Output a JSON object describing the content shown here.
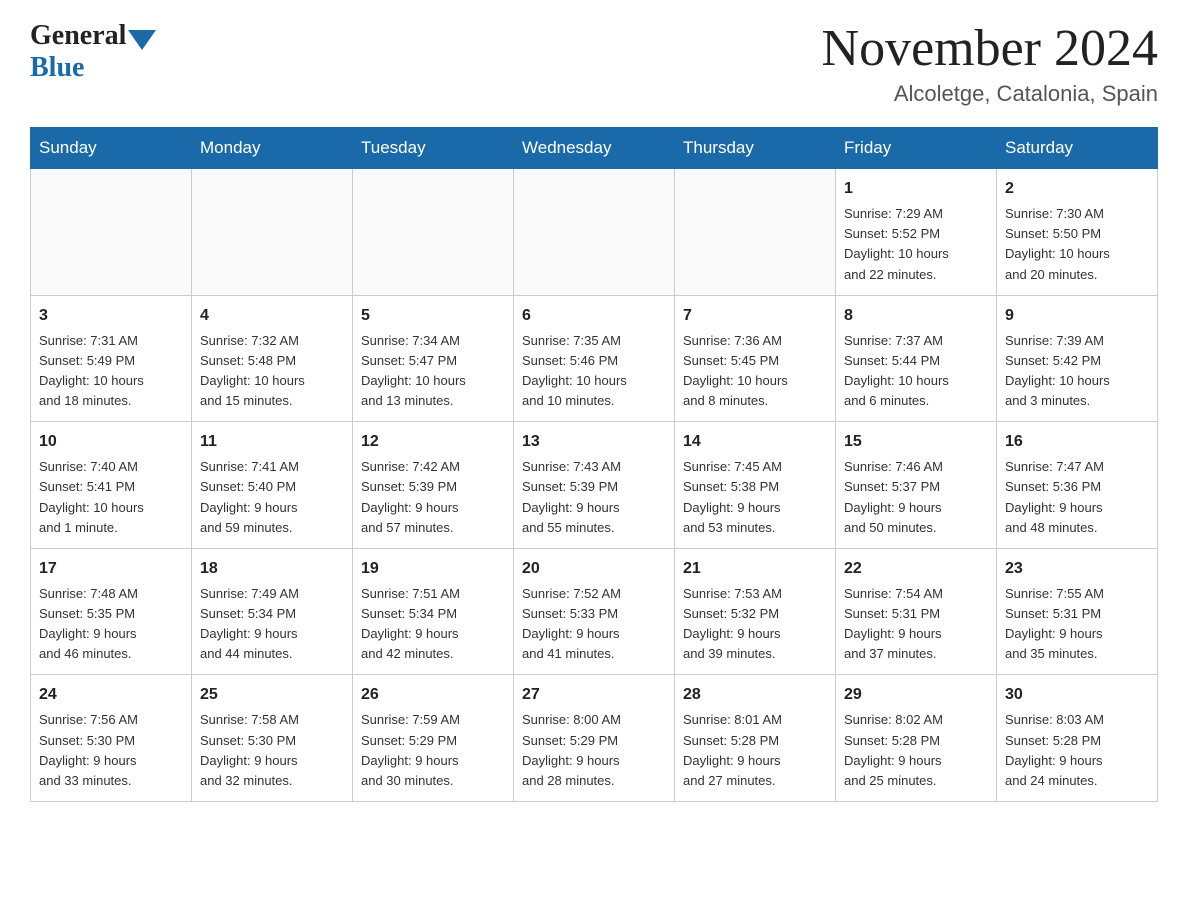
{
  "header": {
    "logo_general": "General",
    "logo_blue": "Blue",
    "month_title": "November 2024",
    "location": "Alcoletge, Catalonia, Spain"
  },
  "weekdays": [
    "Sunday",
    "Monday",
    "Tuesday",
    "Wednesday",
    "Thursday",
    "Friday",
    "Saturday"
  ],
  "weeks": [
    [
      {
        "day": "",
        "info": ""
      },
      {
        "day": "",
        "info": ""
      },
      {
        "day": "",
        "info": ""
      },
      {
        "day": "",
        "info": ""
      },
      {
        "day": "",
        "info": ""
      },
      {
        "day": "1",
        "info": "Sunrise: 7:29 AM\nSunset: 5:52 PM\nDaylight: 10 hours\nand 22 minutes."
      },
      {
        "day": "2",
        "info": "Sunrise: 7:30 AM\nSunset: 5:50 PM\nDaylight: 10 hours\nand 20 minutes."
      }
    ],
    [
      {
        "day": "3",
        "info": "Sunrise: 7:31 AM\nSunset: 5:49 PM\nDaylight: 10 hours\nand 18 minutes."
      },
      {
        "day": "4",
        "info": "Sunrise: 7:32 AM\nSunset: 5:48 PM\nDaylight: 10 hours\nand 15 minutes."
      },
      {
        "day": "5",
        "info": "Sunrise: 7:34 AM\nSunset: 5:47 PM\nDaylight: 10 hours\nand 13 minutes."
      },
      {
        "day": "6",
        "info": "Sunrise: 7:35 AM\nSunset: 5:46 PM\nDaylight: 10 hours\nand 10 minutes."
      },
      {
        "day": "7",
        "info": "Sunrise: 7:36 AM\nSunset: 5:45 PM\nDaylight: 10 hours\nand 8 minutes."
      },
      {
        "day": "8",
        "info": "Sunrise: 7:37 AM\nSunset: 5:44 PM\nDaylight: 10 hours\nand 6 minutes."
      },
      {
        "day": "9",
        "info": "Sunrise: 7:39 AM\nSunset: 5:42 PM\nDaylight: 10 hours\nand 3 minutes."
      }
    ],
    [
      {
        "day": "10",
        "info": "Sunrise: 7:40 AM\nSunset: 5:41 PM\nDaylight: 10 hours\nand 1 minute."
      },
      {
        "day": "11",
        "info": "Sunrise: 7:41 AM\nSunset: 5:40 PM\nDaylight: 9 hours\nand 59 minutes."
      },
      {
        "day": "12",
        "info": "Sunrise: 7:42 AM\nSunset: 5:39 PM\nDaylight: 9 hours\nand 57 minutes."
      },
      {
        "day": "13",
        "info": "Sunrise: 7:43 AM\nSunset: 5:39 PM\nDaylight: 9 hours\nand 55 minutes."
      },
      {
        "day": "14",
        "info": "Sunrise: 7:45 AM\nSunset: 5:38 PM\nDaylight: 9 hours\nand 53 minutes."
      },
      {
        "day": "15",
        "info": "Sunrise: 7:46 AM\nSunset: 5:37 PM\nDaylight: 9 hours\nand 50 minutes."
      },
      {
        "day": "16",
        "info": "Sunrise: 7:47 AM\nSunset: 5:36 PM\nDaylight: 9 hours\nand 48 minutes."
      }
    ],
    [
      {
        "day": "17",
        "info": "Sunrise: 7:48 AM\nSunset: 5:35 PM\nDaylight: 9 hours\nand 46 minutes."
      },
      {
        "day": "18",
        "info": "Sunrise: 7:49 AM\nSunset: 5:34 PM\nDaylight: 9 hours\nand 44 minutes."
      },
      {
        "day": "19",
        "info": "Sunrise: 7:51 AM\nSunset: 5:34 PM\nDaylight: 9 hours\nand 42 minutes."
      },
      {
        "day": "20",
        "info": "Sunrise: 7:52 AM\nSunset: 5:33 PM\nDaylight: 9 hours\nand 41 minutes."
      },
      {
        "day": "21",
        "info": "Sunrise: 7:53 AM\nSunset: 5:32 PM\nDaylight: 9 hours\nand 39 minutes."
      },
      {
        "day": "22",
        "info": "Sunrise: 7:54 AM\nSunset: 5:31 PM\nDaylight: 9 hours\nand 37 minutes."
      },
      {
        "day": "23",
        "info": "Sunrise: 7:55 AM\nSunset: 5:31 PM\nDaylight: 9 hours\nand 35 minutes."
      }
    ],
    [
      {
        "day": "24",
        "info": "Sunrise: 7:56 AM\nSunset: 5:30 PM\nDaylight: 9 hours\nand 33 minutes."
      },
      {
        "day": "25",
        "info": "Sunrise: 7:58 AM\nSunset: 5:30 PM\nDaylight: 9 hours\nand 32 minutes."
      },
      {
        "day": "26",
        "info": "Sunrise: 7:59 AM\nSunset: 5:29 PM\nDaylight: 9 hours\nand 30 minutes."
      },
      {
        "day": "27",
        "info": "Sunrise: 8:00 AM\nSunset: 5:29 PM\nDaylight: 9 hours\nand 28 minutes."
      },
      {
        "day": "28",
        "info": "Sunrise: 8:01 AM\nSunset: 5:28 PM\nDaylight: 9 hours\nand 27 minutes."
      },
      {
        "day": "29",
        "info": "Sunrise: 8:02 AM\nSunset: 5:28 PM\nDaylight: 9 hours\nand 25 minutes."
      },
      {
        "day": "30",
        "info": "Sunrise: 8:03 AM\nSunset: 5:28 PM\nDaylight: 9 hours\nand 24 minutes."
      }
    ]
  ]
}
